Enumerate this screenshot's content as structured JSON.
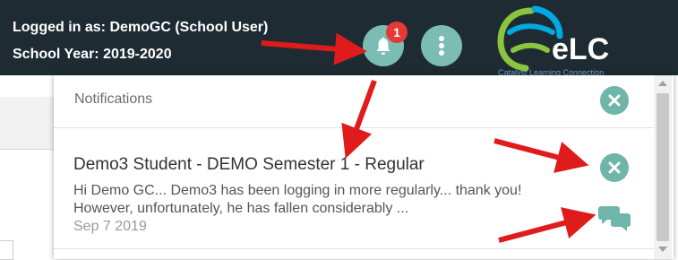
{
  "header": {
    "login_text": "Logged in as: DemoGC (School User)",
    "school_year_text": "School Year: 2019-2020",
    "notification_count": "1",
    "logo_text": "eLC",
    "logo_tagline": "Catalyst Learning Connection"
  },
  "notifications": {
    "title": "Notifications",
    "items": [
      {
        "title": "Demo3 Student - DEMO Semester 1 - Regular",
        "body": "Hi Demo GC... Demo3 has been logging in more regularly... thank you! However, unfortunately, he has fallen considerably ...",
        "date": "Sep 7 2019"
      }
    ]
  },
  "icons": {
    "bell": "bell-icon",
    "menu": "vertical-dots-icon",
    "close": "close-icon",
    "chat": "chat-bubbles-icon"
  },
  "colors": {
    "header_bg": "#1f2b33",
    "accent_teal": "#6fb5aa",
    "badge_red": "#e53935",
    "annotation_red": "#e01b1b"
  }
}
